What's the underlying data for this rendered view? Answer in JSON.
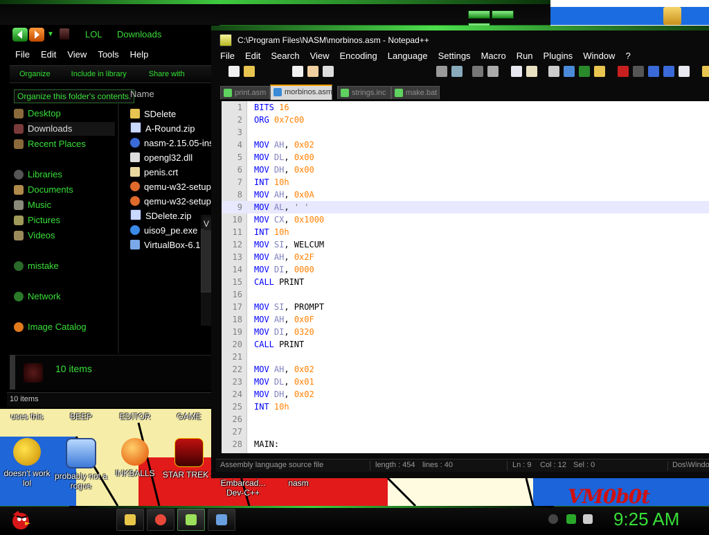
{
  "desktop": {
    "wallpaper_text": "VM0b0t",
    "icons": [
      {
        "label": "uses this",
        "icon": "unknown-icon"
      },
      {
        "label": "BEEP",
        "icon": "unknown-icon"
      },
      {
        "label": "EDITOR",
        "icon": "unknown-icon"
      },
      {
        "label": "GAME",
        "icon": "unknown-icon"
      },
      {
        "label": "doesn't work lol",
        "icon": "yahoo-messenger-icon"
      },
      {
        "label": "probably not a rogue",
        "icon": "gears-icon"
      },
      {
        "label": "INKBALLS",
        "icon": "inkball-icon"
      },
      {
        "label": "STAR TREK 3",
        "icon": "star-wars-icon"
      },
      {
        "label": "Embarcad... Dev-C++",
        "icon": "devcpp-icon"
      },
      {
        "label": "nasm",
        "icon": "nasm-icon"
      }
    ]
  },
  "explorer": {
    "breadcrumb": [
      "LOL",
      "Downloads"
    ],
    "menu": [
      "File",
      "Edit",
      "View",
      "Tools",
      "Help"
    ],
    "command_bar": [
      "Organize",
      "Include in library",
      "Share with"
    ],
    "tooltip": "Organize this folder's contents.",
    "nav": [
      {
        "label": "Desktop",
        "icon": "desktop-icon"
      },
      {
        "label": "Downloads",
        "icon": "downloads-icon",
        "selected": true
      },
      {
        "label": "Recent Places",
        "icon": "recent-places-icon"
      },
      {
        "label": "Libraries",
        "icon": "libraries-icon"
      },
      {
        "label": "Documents",
        "icon": "documents-icon"
      },
      {
        "label": "Music",
        "icon": "music-icon"
      },
      {
        "label": "Pictures",
        "icon": "pictures-icon"
      },
      {
        "label": "Videos",
        "icon": "videos-icon"
      },
      {
        "label": "mistake",
        "icon": "homegroup-icon"
      },
      {
        "label": "Network",
        "icon": "network-icon"
      },
      {
        "label": "Image Catalog",
        "icon": "image-catalog-icon"
      }
    ],
    "column_header": "Name",
    "files": [
      {
        "name": "SDelete",
        "icon": "folder-icon"
      },
      {
        "name": "A-Round.zip",
        "icon": "zip-icon"
      },
      {
        "name": "nasm-2.15.05-ins",
        "icon": "installer-icon"
      },
      {
        "name": "opengl32.dll",
        "icon": "dll-icon"
      },
      {
        "name": "penis.crt",
        "icon": "certificate-icon"
      },
      {
        "name": "qemu-w32-setup",
        "icon": "qemu-icon"
      },
      {
        "name": "qemu-w32-setup",
        "icon": "qemu-icon"
      },
      {
        "name": "SDelete.zip",
        "icon": "zip-icon"
      },
      {
        "name": "uiso9_pe.exe",
        "icon": "exe-icon"
      },
      {
        "name": "VirtualBox-6.1",
        "icon": "virtualbox-icon"
      }
    ],
    "details_count": "10 items",
    "status": "10 items",
    "tooltip_fragment": "V"
  },
  "npp": {
    "title": "C:\\Program Files\\NASM\\morbinos.asm - Notepad++",
    "menu": [
      "File",
      "Edit",
      "Search",
      "View",
      "Encoding",
      "Language",
      "Settings",
      "Macro",
      "Run",
      "Plugins",
      "Window",
      "?"
    ],
    "tabs": [
      {
        "label": "print.asm",
        "active": false
      },
      {
        "label": "morbinos.asm",
        "active": true
      },
      {
        "label": "strings.inc",
        "active": false
      },
      {
        "label": "make.bat",
        "active": false
      }
    ],
    "lines": [
      {
        "n": "1",
        "tokens": [
          {
            "t": "BITS ",
            "c": "kw"
          },
          {
            "t": "16",
            "c": "num"
          }
        ]
      },
      {
        "n": "2",
        "tokens": [
          {
            "t": "ORG ",
            "c": "kw"
          },
          {
            "t": "0x7c00",
            "c": "num"
          }
        ]
      },
      {
        "n": "3",
        "tokens": []
      },
      {
        "n": "4",
        "tokens": [
          {
            "t": "MOV ",
            "c": "kw"
          },
          {
            "t": "AH",
            "c": "reg"
          },
          {
            "t": ", ",
            "c": "plain"
          },
          {
            "t": "0x02",
            "c": "num"
          }
        ]
      },
      {
        "n": "5",
        "tokens": [
          {
            "t": "MOV ",
            "c": "kw"
          },
          {
            "t": "DL",
            "c": "reg"
          },
          {
            "t": ", ",
            "c": "plain"
          },
          {
            "t": "0x00",
            "c": "num"
          }
        ]
      },
      {
        "n": "6",
        "tokens": [
          {
            "t": "MOV ",
            "c": "kw"
          },
          {
            "t": "DH",
            "c": "reg"
          },
          {
            "t": ", ",
            "c": "plain"
          },
          {
            "t": "0x00",
            "c": "num"
          }
        ]
      },
      {
        "n": "7",
        "tokens": [
          {
            "t": "INT ",
            "c": "kw"
          },
          {
            "t": "10h",
            "c": "num"
          }
        ]
      },
      {
        "n": "8",
        "tokens": [
          {
            "t": "MOV ",
            "c": "kw"
          },
          {
            "t": "AH",
            "c": "reg"
          },
          {
            "t": ", ",
            "c": "plain"
          },
          {
            "t": "0x0A",
            "c": "num"
          }
        ]
      },
      {
        "n": "9",
        "tokens": [
          {
            "t": "MOV ",
            "c": "kw"
          },
          {
            "t": "AL",
            "c": "reg"
          },
          {
            "t": ", ",
            "c": "plain"
          },
          {
            "t": "' '",
            "c": "str"
          }
        ],
        "current": true
      },
      {
        "n": "10",
        "tokens": [
          {
            "t": "MOV ",
            "c": "kw"
          },
          {
            "t": "CX",
            "c": "reg"
          },
          {
            "t": ", ",
            "c": "plain"
          },
          {
            "t": "0x1000",
            "c": "num"
          }
        ]
      },
      {
        "n": "11",
        "tokens": [
          {
            "t": "INT ",
            "c": "kw"
          },
          {
            "t": "10h",
            "c": "num"
          }
        ]
      },
      {
        "n": "12",
        "tokens": [
          {
            "t": "MOV ",
            "c": "kw"
          },
          {
            "t": "SI",
            "c": "reg"
          },
          {
            "t": ", WELCUM",
            "c": "plain"
          }
        ]
      },
      {
        "n": "13",
        "tokens": [
          {
            "t": "MOV ",
            "c": "kw"
          },
          {
            "t": "AH",
            "c": "reg"
          },
          {
            "t": ", ",
            "c": "plain"
          },
          {
            "t": "0x2F",
            "c": "num"
          }
        ]
      },
      {
        "n": "14",
        "tokens": [
          {
            "t": "MOV ",
            "c": "kw"
          },
          {
            "t": "DI",
            "c": "reg"
          },
          {
            "t": ", ",
            "c": "plain"
          },
          {
            "t": "0000",
            "c": "num"
          }
        ]
      },
      {
        "n": "15",
        "tokens": [
          {
            "t": "CALL ",
            "c": "kw"
          },
          {
            "t": "PRINT",
            "c": "plain"
          }
        ]
      },
      {
        "n": "16",
        "tokens": []
      },
      {
        "n": "17",
        "tokens": [
          {
            "t": "MOV ",
            "c": "kw"
          },
          {
            "t": "SI",
            "c": "reg"
          },
          {
            "t": ", PROMPT",
            "c": "plain"
          }
        ]
      },
      {
        "n": "18",
        "tokens": [
          {
            "t": "MOV ",
            "c": "kw"
          },
          {
            "t": "AH",
            "c": "reg"
          },
          {
            "t": ", ",
            "c": "plain"
          },
          {
            "t": "0x0F",
            "c": "num"
          }
        ]
      },
      {
        "n": "19",
        "tokens": [
          {
            "t": "MOV ",
            "c": "kw"
          },
          {
            "t": "DI",
            "c": "reg"
          },
          {
            "t": ", ",
            "c": "plain"
          },
          {
            "t": "0320",
            "c": "num"
          }
        ]
      },
      {
        "n": "20",
        "tokens": [
          {
            "t": "CALL ",
            "c": "kw"
          },
          {
            "t": "PRINT",
            "c": "plain"
          }
        ]
      },
      {
        "n": "21",
        "tokens": []
      },
      {
        "n": "22",
        "tokens": [
          {
            "t": "MOV ",
            "c": "kw"
          },
          {
            "t": "AH",
            "c": "reg"
          },
          {
            "t": ", ",
            "c": "plain"
          },
          {
            "t": "0x02",
            "c": "num"
          }
        ]
      },
      {
        "n": "23",
        "tokens": [
          {
            "t": "MOV ",
            "c": "kw"
          },
          {
            "t": "DL",
            "c": "reg"
          },
          {
            "t": ", ",
            "c": "plain"
          },
          {
            "t": "0x01",
            "c": "num"
          }
        ]
      },
      {
        "n": "24",
        "tokens": [
          {
            "t": "MOV ",
            "c": "kw"
          },
          {
            "t": "DH",
            "c": "reg"
          },
          {
            "t": ", ",
            "c": "plain"
          },
          {
            "t": "0x02",
            "c": "num"
          }
        ]
      },
      {
        "n": "25",
        "tokens": [
          {
            "t": "INT ",
            "c": "kw"
          },
          {
            "t": "10h",
            "c": "num"
          }
        ]
      },
      {
        "n": "26",
        "tokens": []
      },
      {
        "n": "27",
        "tokens": []
      },
      {
        "n": "28",
        "tokens": [
          {
            "t": "MAIN:",
            "c": "plain"
          }
        ]
      }
    ],
    "status": {
      "type": "Assembly language source file",
      "length": "length : 454",
      "lines": "lines : 40",
      "ln": "Ln : 9",
      "col": "Col : 12",
      "sel": "Sel : 0",
      "eol": "Dos\\Windows"
    }
  },
  "taskbar": {
    "programs": [
      {
        "name": "windows-explorer-icon",
        "color": "#e8c64a"
      },
      {
        "name": "chrome-icon",
        "color": "#e8483a"
      },
      {
        "name": "notepad-plus-plus-icon",
        "color": "#9be05a"
      },
      {
        "name": "virtualbox-icon",
        "color": "#6aa0e0"
      }
    ],
    "clock": "9:25 AM"
  },
  "colors": {
    "accent_green": "#38e038",
    "keyword_blue": "#0000ff",
    "number_orange": "#ff8000",
    "register_blue": "#8080c0"
  }
}
